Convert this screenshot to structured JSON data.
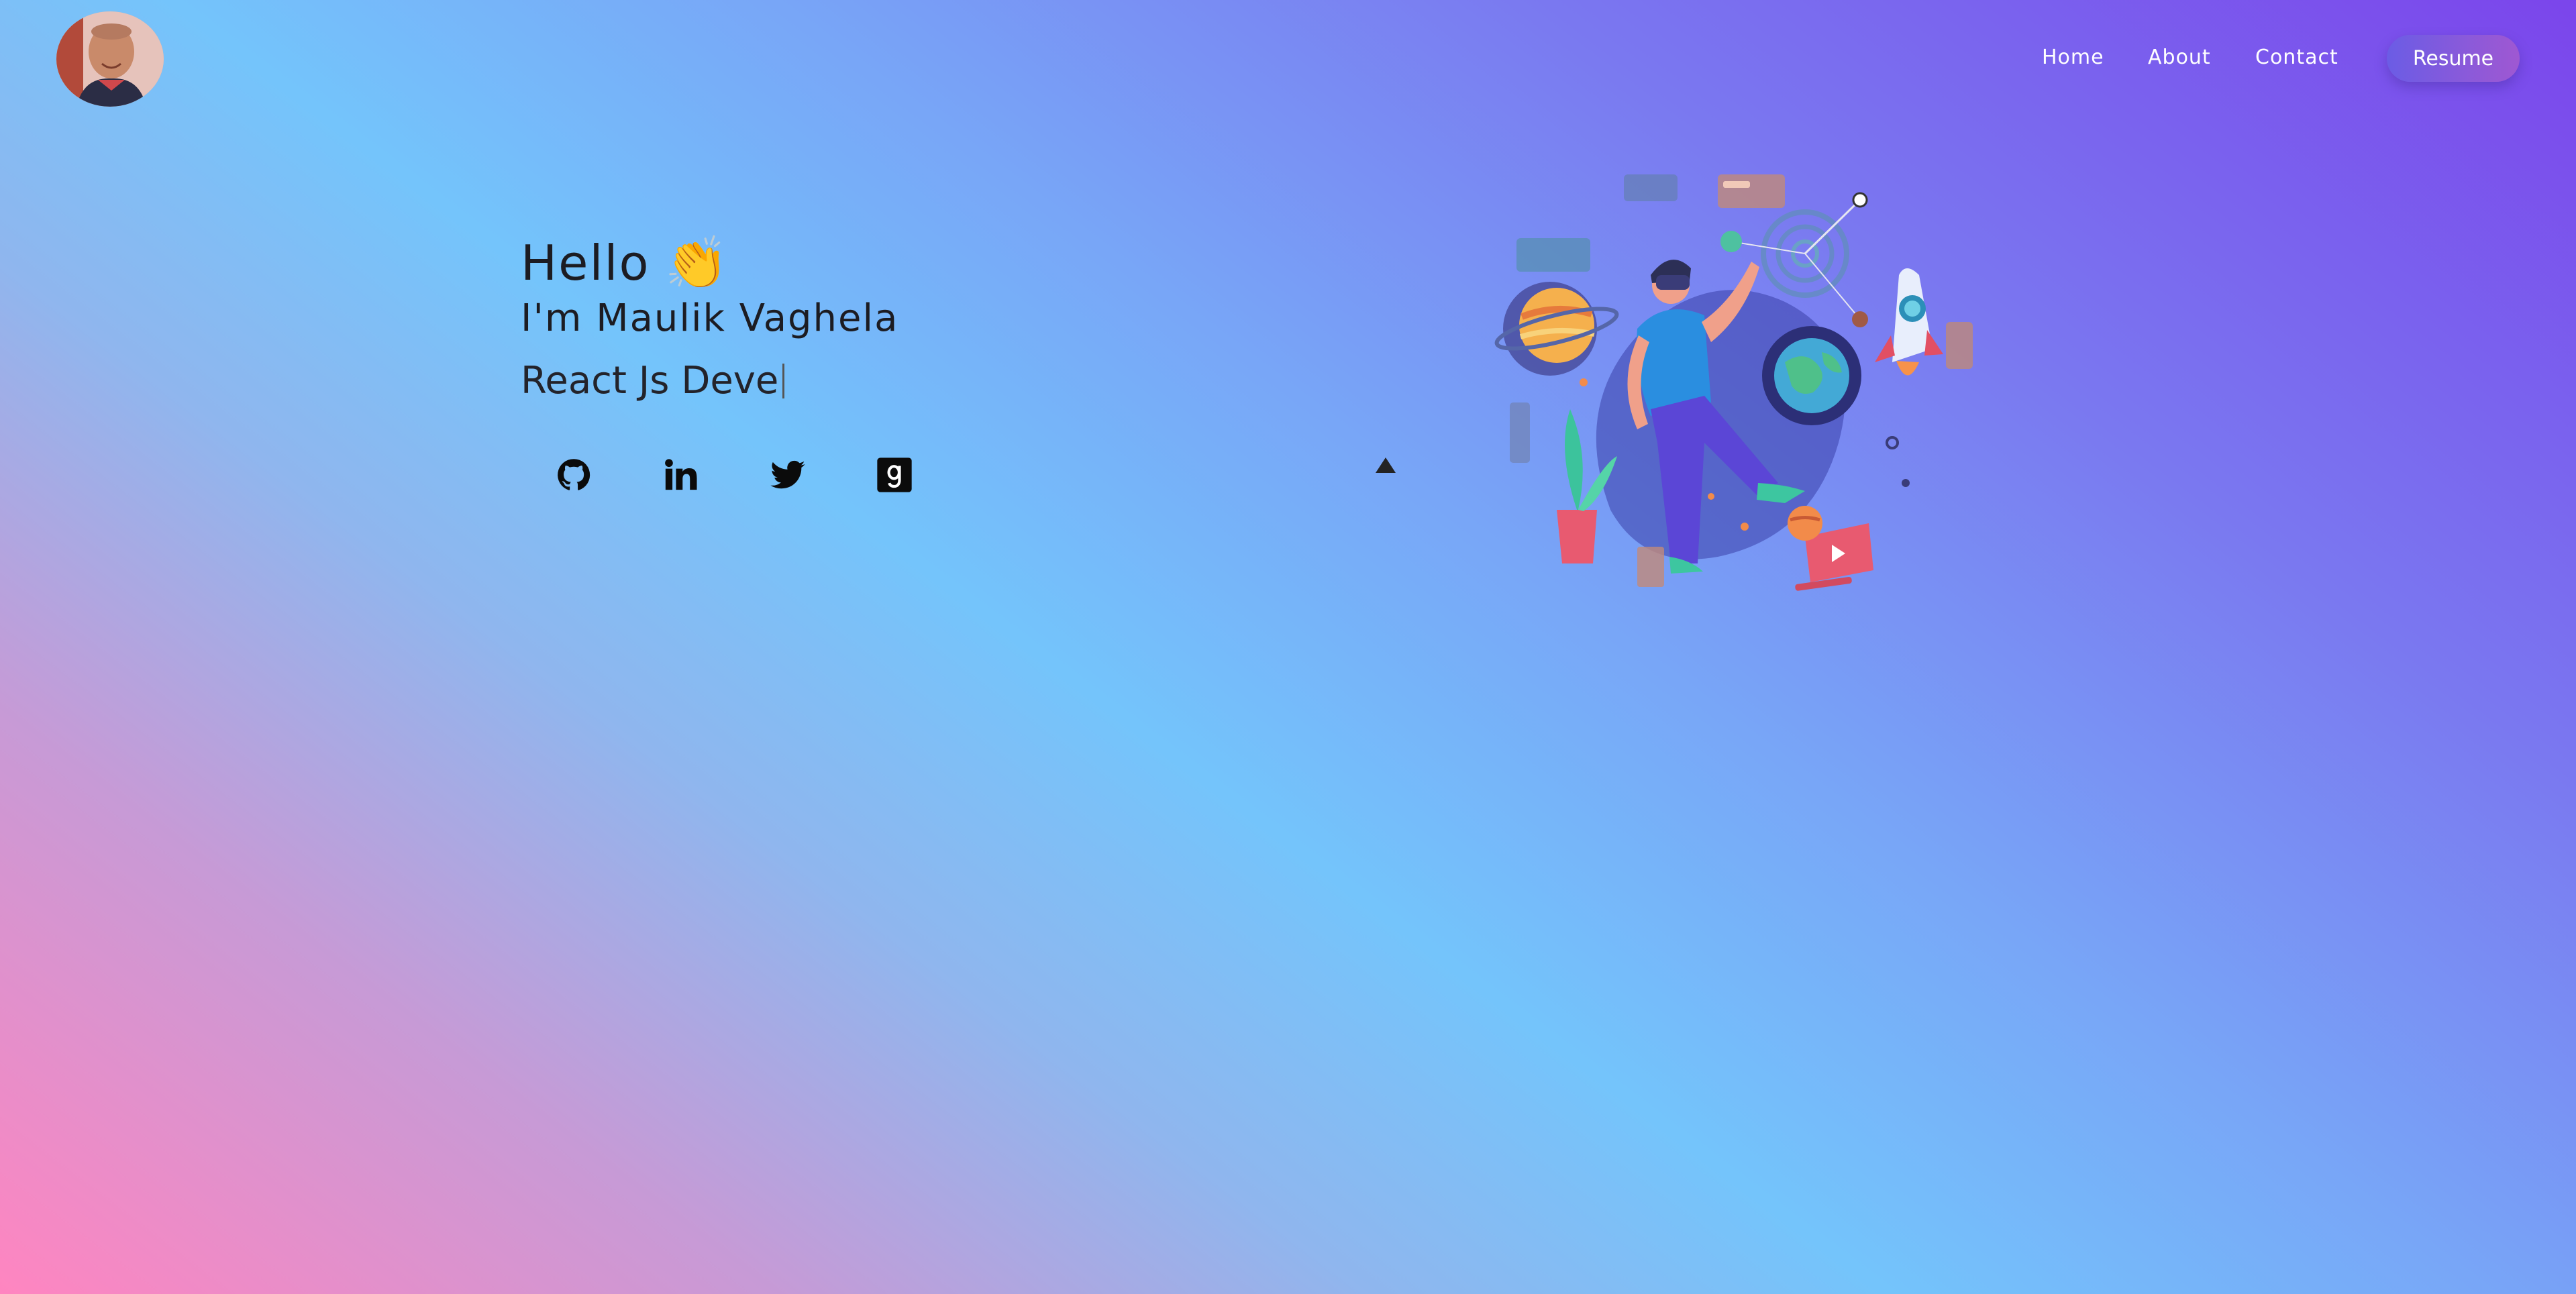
{
  "nav": {
    "links": [
      {
        "label": "Home"
      },
      {
        "label": "About"
      },
      {
        "label": "Contact"
      }
    ],
    "resume_label": "Resume"
  },
  "hero": {
    "greeting": "Hello",
    "greeting_emoji": "👏",
    "name_line": "I'm Maulik Vaghela",
    "role_typed": "React Js Deve"
  },
  "social": [
    {
      "icon": "github-icon"
    },
    {
      "icon": "linkedin-icon"
    },
    {
      "icon": "twitter-icon"
    },
    {
      "icon": "goodreads-icon"
    }
  ],
  "colors": {
    "gradient_pink": "#ff85c0",
    "gradient_sky": "#74c4fb",
    "gradient_purple": "#7b45eb",
    "resume_button": "#7d5ad9",
    "text": "#1c1c22"
  }
}
